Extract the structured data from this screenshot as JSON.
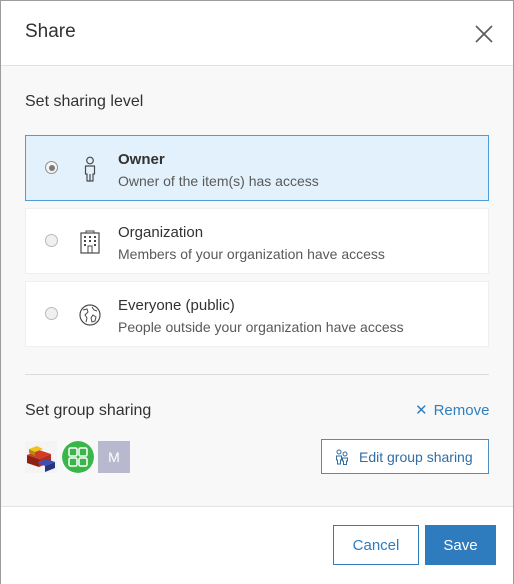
{
  "dialog": {
    "title": "Share"
  },
  "sharing_level": {
    "heading": "Set sharing level",
    "selected": "owner",
    "options": [
      {
        "id": "owner",
        "title": "Owner",
        "description": "Owner of the item(s) has access",
        "icon": "person-icon"
      },
      {
        "id": "organization",
        "title": "Organization",
        "description": "Members of your organization have access",
        "icon": "building-icon"
      },
      {
        "id": "everyone",
        "title": "Everyone (public)",
        "description": "People outside your organization have access",
        "icon": "globe-icon"
      }
    ]
  },
  "group_sharing": {
    "heading": "Set group sharing",
    "remove_label": "Remove",
    "groups": [
      {
        "icon": "group-thumbnail-blocks"
      },
      {
        "icon": "group-thumbnail-grid"
      },
      {
        "initial": "M"
      }
    ],
    "edit_label": "Edit group sharing"
  },
  "footer": {
    "cancel_label": "Cancel",
    "save_label": "Save"
  },
  "colors": {
    "accent": "#2e7bbd",
    "selected_bg": "#e2f1fb",
    "selected_border": "#4d9ed8"
  }
}
